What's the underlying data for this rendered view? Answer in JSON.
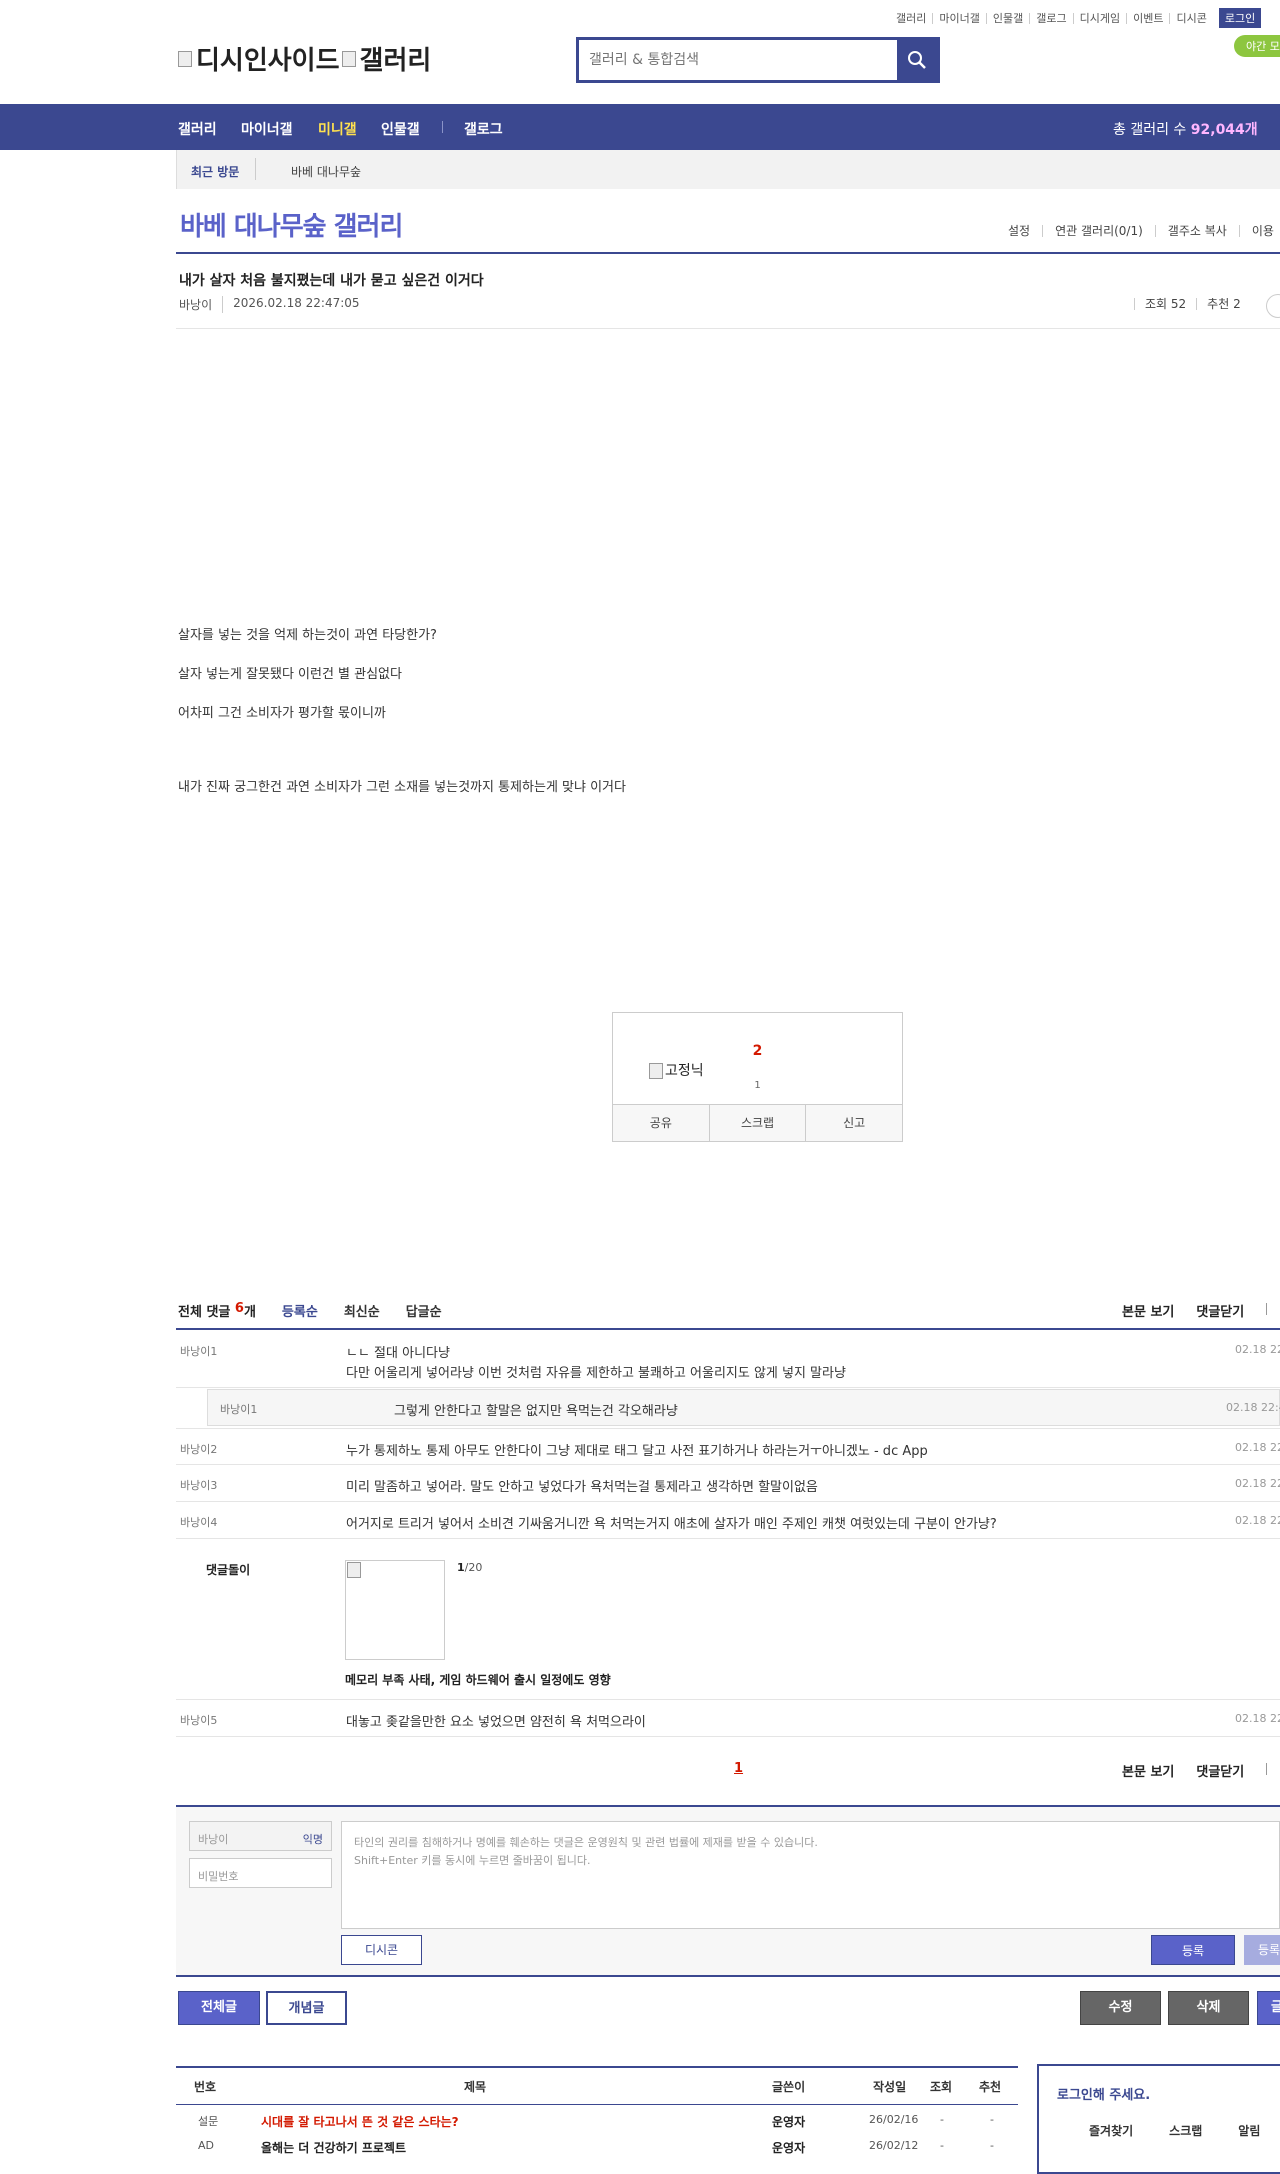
{
  "header": {
    "util_links": [
      "갤러리",
      "마이너갤",
      "인물갤",
      "갤로그",
      "디시게임",
      "이벤트",
      "디시콘"
    ],
    "login_label": "로그인",
    "night_mode_label": "야간 모",
    "logo_text_1": "디시인사이드",
    "logo_text_2": "갤러리",
    "search_placeholder": "갤러리 & 통합검색"
  },
  "gnb": {
    "items": [
      "갤러리",
      "마이너갤",
      "미니갤",
      "인물갤",
      "갤로그"
    ],
    "active_index": 2,
    "total_label": "총 갤러리 수",
    "total_value": "92,044개"
  },
  "recent": {
    "label": "최근 방문",
    "item": "바베 대나무숲"
  },
  "gallery": {
    "title": "바베 대나무숲 갤러리",
    "menu": [
      "설정",
      "연관 갤러리(0/1)",
      "갤주소 복사",
      "이용"
    ]
  },
  "post": {
    "title": "내가 살자 처음 불지폈는데 내가 묻고 싶은건 이거다",
    "author": "바낭이",
    "date": "2026.02.18 22:47:05",
    "views_label": "조회 52",
    "recommend_label": "추천 2",
    "body": [
      "살자를 넣는 것을 억제 하는것이 과연 타당한가?",
      "살자 넣는게 잘못됐다 이런건 별 관심없다",
      "어차피 그건 소비자가 평가할 몫이니까",
      "내가 진짜 궁그한건 과연 소비자가 그런 소재를 넣는것까지 통제하는게 맞냐 이거다"
    ]
  },
  "recommend_box": {
    "count": "2",
    "image_alt": "고정닉",
    "sub_count": "1",
    "buttons": [
      "공유",
      "스크랩",
      "신고"
    ]
  },
  "comments": {
    "total_label": "전체 댓글",
    "total_count": "6",
    "total_unit": "개",
    "tabs": [
      "등록순",
      "최신순",
      "답글순"
    ],
    "right_links": [
      "본문 보기",
      "댓글닫기"
    ],
    "items": [
      {
        "nick": "바낭이1",
        "lines": [
          "ㄴㄴ 절대 아니다냥",
          "다만 어울리게 넣어라냥 이번 것처럼 자유를 제한하고 불쾌하고 어울리지도 않게 넣지 말라냥"
        ],
        "date": "02.18 22"
      },
      {
        "nick": "바낭이1",
        "lines": [
          "그렇게 안한다고 할말은 없지만 욕먹는건 각오해라냥"
        ],
        "date": "02.18 22:4",
        "reply": true
      },
      {
        "nick": "바낭이2",
        "lines": [
          "누가 통제하노 통제 아무도 안한다이 그냥 제대로 태그 달고 사전 표기하거나 하라는거ㅜ아니겠노 - dc App"
        ],
        "date": "02.18 22"
      },
      {
        "nick": "바낭이3",
        "lines": [
          "미리 말좀하고 넣어라. 말도 안하고 넣었다가 욕처먹는걸 통제라고 생각하면 할말이없음"
        ],
        "date": "02.18 22"
      },
      {
        "nick": "바낭이4",
        "lines": [
          "어거지로 트리거 넣어서 소비견 기싸움거니깐 욕 처먹는거지 애초에 살자가 매인 주제인 캐챗 여럿있는데 구분이 안가냥?"
        ],
        "date": "02.18 22"
      },
      {
        "nick": "바낭이5",
        "lines": [
          "대놓고 좆같을만한 요소 넣었으면 얌전히 욕 처먹으라이"
        ],
        "date": "02.18 22"
      }
    ],
    "bot": {
      "nick": "댓글돌이",
      "page": "1/20",
      "page_bold": "1",
      "page_rest": "/20",
      "headline": "메모리 부족 사태, 게임 하드웨어 출시 일정에도 영향"
    },
    "pager": "1"
  },
  "write": {
    "nick_placeholder": "바낭이",
    "anon_label": "익명",
    "pw_placeholder": "비밀번호",
    "notice_1": "타인의 권리를 침해하거나 명예를 훼손하는 댓글은 운영원칙 및 관련 법률에 제재를 받을 수 있습니다.",
    "notice_2": "Shift+Enter 키를 동시에 누르면 줄바꿈이 됩니다.",
    "dccon_label": "디시콘",
    "register_label": "등록",
    "register2_label": "등록"
  },
  "buttons": {
    "all": "전체글",
    "concept": "개념글",
    "edit": "수정",
    "delete": "삭제",
    "write": "글"
  },
  "list": {
    "headers": [
      "번호",
      "제목",
      "글쓴이",
      "작성일",
      "조회",
      "추천"
    ],
    "rows": [
      {
        "no": "설문",
        "title": "시대를 잘 타고나서 뜬 것 같은 스타는?",
        "writer": "운영자",
        "date": "26/02/16",
        "views": "-",
        "rec": "-",
        "title_color": "#d31900"
      },
      {
        "no": "AD",
        "title": "올해는 더 건강하기 프로젝트",
        "writer": "운영자",
        "date": "26/02/12",
        "views": "-",
        "rec": "-",
        "title_color": "#222"
      }
    ]
  },
  "side": {
    "login_prompt": "로그인해 주세요.",
    "links": [
      "즐겨찾기",
      "스크랩",
      "알림"
    ]
  }
}
